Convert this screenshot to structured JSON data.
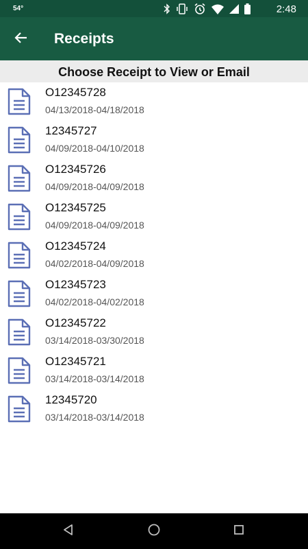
{
  "status_bar": {
    "temperature": "54°",
    "time": "2:48",
    "icons": [
      "bluetooth-icon",
      "vibrate-icon",
      "alarm-icon",
      "wifi-icon",
      "signal-icon",
      "battery-icon"
    ]
  },
  "app_bar": {
    "back_icon": "arrow-back-icon",
    "title": "Receipts"
  },
  "subheader": {
    "text": "Choose Receipt to View or Email"
  },
  "receipts": [
    {
      "number": "O12345728",
      "dates": "04/13/2018-04/18/2018"
    },
    {
      "number": "12345727",
      "dates": "04/09/2018-04/10/2018"
    },
    {
      "number": "O12345726",
      "dates": "04/09/2018-04/09/2018"
    },
    {
      "number": "O12345725",
      "dates": "04/09/2018-04/09/2018"
    },
    {
      "number": "O12345724",
      "dates": "04/02/2018-04/09/2018"
    },
    {
      "number": "O12345723",
      "dates": "04/02/2018-04/02/2018"
    },
    {
      "number": "O12345722",
      "dates": "03/14/2018-03/30/2018"
    },
    {
      "number": "O12345721",
      "dates": "03/14/2018-03/14/2018"
    },
    {
      "number": "12345720",
      "dates": "03/14/2018-03/14/2018"
    }
  ],
  "nav_bar": {
    "icons": [
      "nav-back-icon",
      "nav-home-icon",
      "nav-recents-icon"
    ]
  },
  "colors": {
    "status_bar": "#13503a",
    "app_bar": "#185b42",
    "subheader_bg": "#ececec",
    "document_icon": "#5b6fb5",
    "nav_bar": "#000000"
  }
}
